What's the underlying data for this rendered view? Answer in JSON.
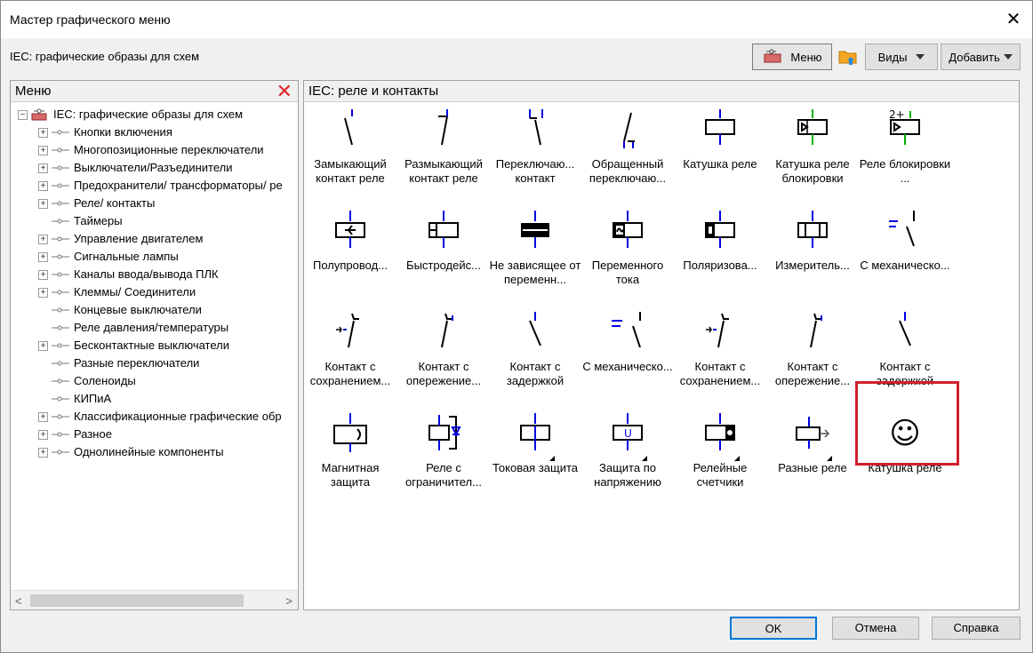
{
  "window": {
    "title": "Мастер графического меню",
    "close_glyph": "✕"
  },
  "subheader": {
    "title": "IEC: графические образы для схем"
  },
  "toolbar": {
    "menu_label": "Меню",
    "views_label": "Виды",
    "add_label": "Добавить"
  },
  "left_panel": {
    "header": "Меню",
    "tree": [
      {
        "label": "IEC: графические образы для схем",
        "expander": "−",
        "level": 0
      },
      {
        "label": "Кнопки включения",
        "expander": "+",
        "level": 1
      },
      {
        "label": "Многопозиционные переключатели",
        "expander": "+",
        "level": 1
      },
      {
        "label": "Выключатели/Разъединители",
        "expander": "+",
        "level": 1
      },
      {
        "label": "Предохранители/ трансформаторы/ ре",
        "expander": "+",
        "level": 1
      },
      {
        "label": "Реле/ контакты",
        "expander": "+",
        "level": 1,
        "selected": true
      },
      {
        "label": "Таймеры",
        "expander": "",
        "level": 1
      },
      {
        "label": "Управление двигателем",
        "expander": "+",
        "level": 1
      },
      {
        "label": "Сигнальные лампы",
        "expander": "+",
        "level": 1
      },
      {
        "label": "Каналы ввода/вывода ПЛК",
        "expander": "+",
        "level": 1
      },
      {
        "label": "Клеммы/ Соединители",
        "expander": "+",
        "level": 1
      },
      {
        "label": "Концевые выключатели",
        "expander": "",
        "level": 1
      },
      {
        "label": "Реле давления/температуры",
        "expander": "",
        "level": 1
      },
      {
        "label": "Бесконтактные выключатели",
        "expander": "+",
        "level": 1
      },
      {
        "label": "Разные переключатели",
        "expander": "",
        "level": 1
      },
      {
        "label": "Соленоиды",
        "expander": "",
        "level": 1
      },
      {
        "label": "КИПиА",
        "expander": "",
        "level": 1
      },
      {
        "label": "Классификационные графические обр",
        "expander": "+",
        "level": 1
      },
      {
        "label": "Разное",
        "expander": "+",
        "level": 1
      },
      {
        "label": "Однолинейные компоненты",
        "expander": "+",
        "level": 1
      }
    ],
    "scroll_left": "<",
    "scroll_right": ">"
  },
  "right_panel": {
    "header": "IEC: реле и контакты",
    "tiles": [
      {
        "label": "Замыкающий контакт реле",
        "icon": "no-contact-icon"
      },
      {
        "label": "Размыкающий контакт реле",
        "icon": "nc-contact-icon"
      },
      {
        "label": "Переключаю... контакт",
        "icon": "changeover-contact-icon"
      },
      {
        "label": "Обращенный переключаю...",
        "icon": "reversed-changeover-icon"
      },
      {
        "label": "Катушка реле",
        "icon": "relay-coil-icon"
      },
      {
        "label": "Катушка реле блокировки",
        "icon": "latching-coil-icon"
      },
      {
        "label": "Реле блокировки ...",
        "icon": "latching-relay-icon"
      },
      {
        "label": "Полупровод...",
        "icon": "semiconductor-relay-icon"
      },
      {
        "label": "Быстродейс...",
        "icon": "fast-relay-icon"
      },
      {
        "label": "Не зависящее от переменн...",
        "icon": "ac-independent-relay-icon"
      },
      {
        "label": "Переменного тока",
        "icon": "ac-relay-icon"
      },
      {
        "label": "Поляризова...",
        "icon": "polarized-relay-icon"
      },
      {
        "label": "Измеритель...",
        "icon": "measuring-relay-icon"
      },
      {
        "label": "С механическо...",
        "icon": "mechanical-contact-icon"
      },
      {
        "label": "Контакт с сохранением...",
        "icon": "retained-contact-icon"
      },
      {
        "label": "Контакт с опережение...",
        "icon": "leading-contact-icon"
      },
      {
        "label": "Контакт с задержкой",
        "icon": "delayed-contact-icon"
      },
      {
        "label": "С механическо...",
        "icon": "mechanical-contact-2-icon"
      },
      {
        "label": "Контакт с сохранением...",
        "icon": "retained-contact-2-icon"
      },
      {
        "label": "Контакт с опережение...",
        "icon": "leading-contact-2-icon"
      },
      {
        "label": "Контакт с задержкой",
        "icon": "delayed-contact-2-icon"
      },
      {
        "label": "Магнитная защита",
        "icon": "magnetic-protection-icon"
      },
      {
        "label": "Реле с ограничител...",
        "icon": "limiter-relay-icon"
      },
      {
        "label": "Токовая защита",
        "icon": "current-protection-icon",
        "submenu": true
      },
      {
        "label": "Защита по напряжению",
        "icon": "voltage-protection-icon",
        "submenu": true
      },
      {
        "label": "Релейные счетчики",
        "icon": "relay-counter-icon",
        "submenu": true
      },
      {
        "label": "Разные реле",
        "icon": "misc-relay-icon",
        "submenu": true
      },
      {
        "label": "Катушка реле",
        "icon": "smiley-icon",
        "glyph": "☺"
      }
    ]
  },
  "footer": {
    "ok_label": "OK",
    "cancel_label": "Отмена",
    "help_label": "Справка"
  },
  "extras": {
    "latch_mark": "2+",
    "voltage_mark": "U"
  },
  "colors": {
    "accent_blue": "#0000e0",
    "accent_green": "#00b000",
    "highlight_red": "#d0202a",
    "ok_border": "#0078d7"
  }
}
